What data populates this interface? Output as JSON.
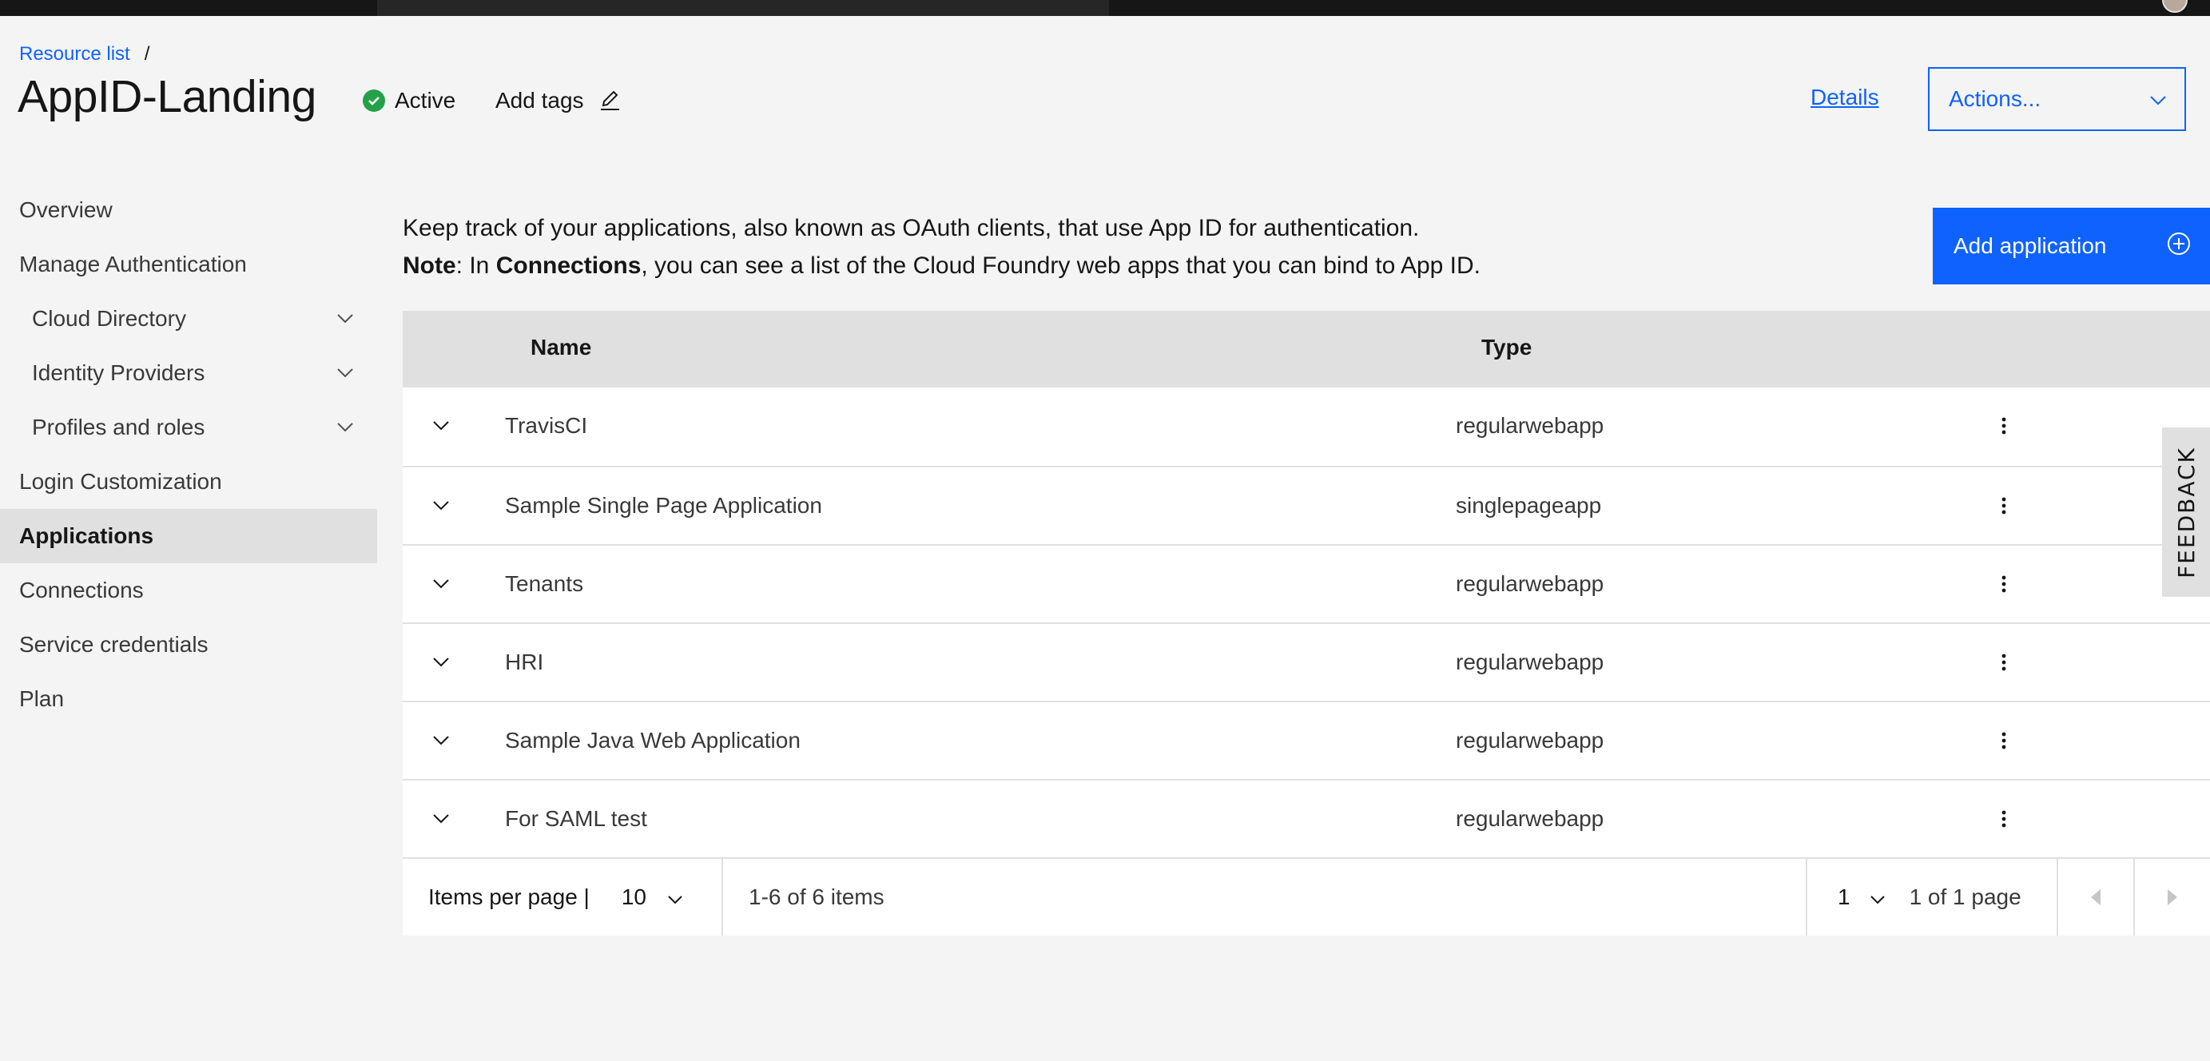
{
  "colors": {
    "brand_blue": "#0f62fe",
    "status_active": "#24a148",
    "topbar": "#161616",
    "selected_nav": "#e0e0e0"
  },
  "header": {
    "breadcrumb": [
      {
        "label": "Resource list"
      }
    ],
    "breadcrumb_separator": "/",
    "title": "AppID-Landing",
    "status": {
      "label": "Active",
      "icon": "check-circle-icon"
    },
    "add_tags_label": "Add tags",
    "details_label": "Details",
    "actions_label": "Actions..."
  },
  "sidebar": {
    "items": [
      {
        "label": "Overview",
        "sub": false,
        "expandable": false,
        "active": false
      },
      {
        "label": "Manage Authentication",
        "sub": false,
        "expandable": false,
        "active": false
      },
      {
        "label": "Cloud Directory",
        "sub": true,
        "expandable": true,
        "active": false
      },
      {
        "label": "Identity Providers",
        "sub": true,
        "expandable": true,
        "active": false
      },
      {
        "label": "Profiles and roles",
        "sub": true,
        "expandable": true,
        "active": false
      },
      {
        "label": "Login Customization",
        "sub": false,
        "expandable": false,
        "active": false
      },
      {
        "label": "Applications",
        "sub": false,
        "expandable": false,
        "active": true
      },
      {
        "label": "Connections",
        "sub": false,
        "expandable": false,
        "active": false
      },
      {
        "label": "Service credentials",
        "sub": false,
        "expandable": false,
        "active": false
      },
      {
        "label": "Plan",
        "sub": false,
        "expandable": false,
        "active": false
      }
    ]
  },
  "main": {
    "description_line1": "Keep track of your applications, also known as OAuth clients, that use App ID for authentication.",
    "note_label": "Note",
    "note_prefix": ": In ",
    "note_link": "Connections",
    "note_suffix": ", you can see a list of the Cloud Foundry web apps that you can bind to App ID.",
    "add_application_label": "Add application",
    "table": {
      "columns": [
        "Name",
        "Type"
      ],
      "rows": [
        {
          "name": "TravisCI",
          "type": "regularwebapp"
        },
        {
          "name": "Sample Single Page Application",
          "type": "singlepageapp"
        },
        {
          "name": "Tenants",
          "type": "regularwebapp"
        },
        {
          "name": "HRI",
          "type": "regularwebapp"
        },
        {
          "name": "Sample Java Web Application",
          "type": "regularwebapp"
        },
        {
          "name": "For SAML test",
          "type": "regularwebapp"
        }
      ]
    },
    "pagination": {
      "items_per_page_label": "Items per page |",
      "items_per_page_value": "10",
      "range_text": "1-6 of 6 items",
      "page_value": "1",
      "page_of_text": "1 of 1 page"
    }
  },
  "feedback_label": "FEEDBACK"
}
